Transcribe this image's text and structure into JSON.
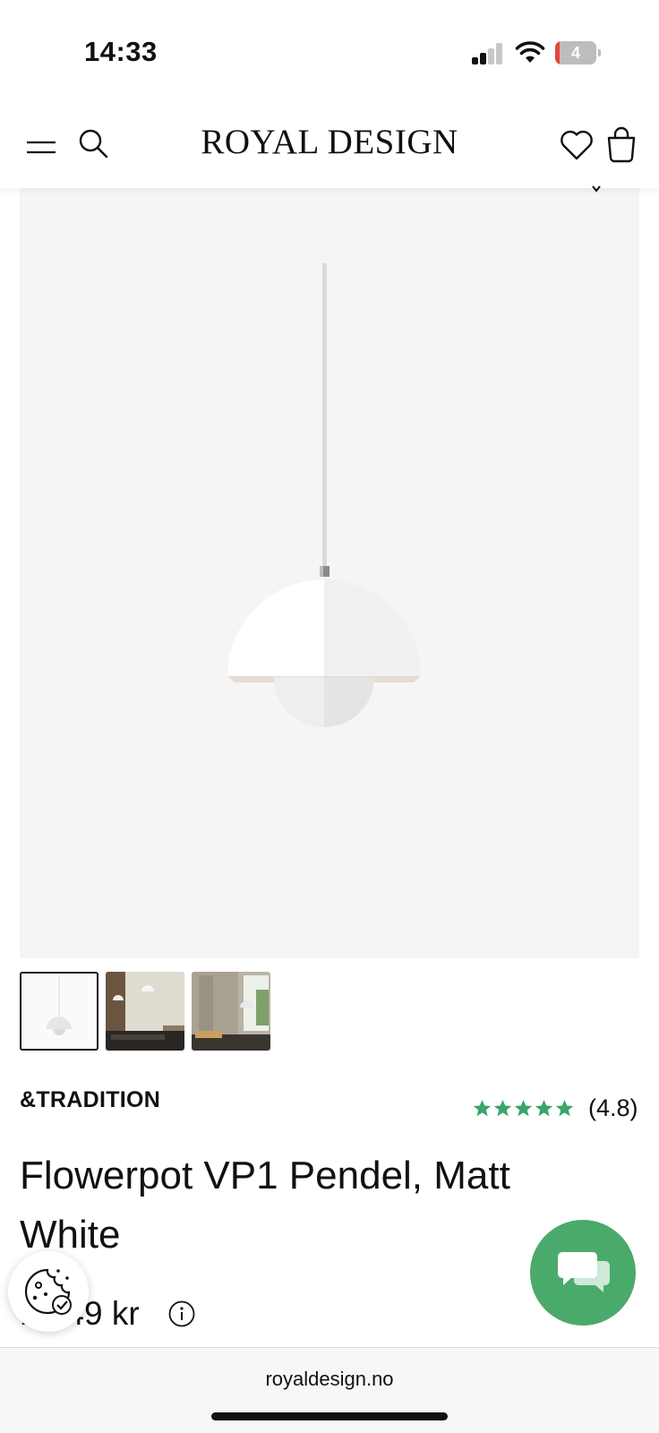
{
  "status_bar": {
    "time": "14:33",
    "battery_level": "4",
    "battery_fraction": 0.04,
    "signal_bars_active": 2,
    "signal_bars_total": 4,
    "icons": [
      "cellular-signal-icon",
      "wifi-icon",
      "battery-icon"
    ]
  },
  "header": {
    "brand": "ROYAL DESIGN",
    "icons": [
      "menu-icon",
      "search-icon",
      "heart-icon",
      "shopping-bag-icon"
    ]
  },
  "product": {
    "image_alt": "Flowerpot VP1 Pendel, Matt White",
    "thumbnails_count": 3,
    "active_thumbnail": 1,
    "brand": "&TRADITION",
    "rating_stars": 5,
    "rating_value": "(4.8)",
    "title": "Flowerpot VP1 Pendel, Matt White",
    "price": "1 749 kr"
  },
  "floating": {
    "cookie_icon": "cookie-settings-icon",
    "chat_icon": "chat-icon"
  },
  "browser": {
    "url": "royaldesign.no"
  },
  "colors": {
    "accent_green": "#4aaa6b",
    "star_green": "#3aa46a",
    "text": "#111111",
    "image_bg": "#f5f5f5",
    "battery_low": "#e5483a"
  }
}
